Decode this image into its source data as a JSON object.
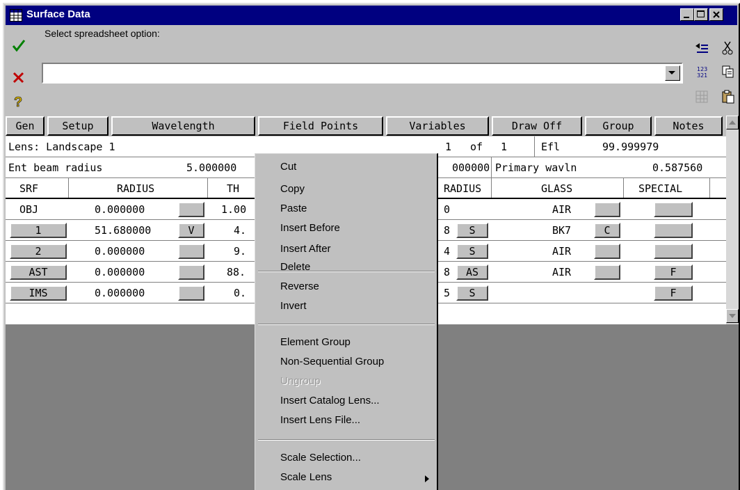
{
  "window": {
    "title": "Surface Data"
  },
  "toolbar": {
    "select_label": "Select spreadsheet option:",
    "option_value": ""
  },
  "tabs": [
    "Gen",
    "Setup",
    "Wavelength",
    "Field Points",
    "Variables",
    "Draw Off",
    "Group",
    "Notes"
  ],
  "info_row1": {
    "lens": "Lens: Landscape 1",
    "config": "1",
    "of": "of",
    "config_total": "1",
    "efl_label": "Efl",
    "efl_value": "99.999979"
  },
  "info_row2": {
    "ent_label": "Ent beam radius",
    "ent_value": "5.000000",
    "mid_value": "000000",
    "prim_label": "Primary wavln",
    "prim_value": "0.587560"
  },
  "columns": {
    "srf": "SRF",
    "radius": "RADIUS",
    "thickness": "TH",
    "ap_radius": "RADIUS",
    "glass": "GLASS",
    "special": "SPECIAL"
  },
  "rows": [
    {
      "srf": "OBJ",
      "radius": "0.000000",
      "radius_flag": "",
      "thick": "1.00",
      "ap": "0",
      "ap_flag": "",
      "glass": "AIR",
      "glass_flag": "",
      "special": ""
    },
    {
      "srf": "1",
      "radius": "51.680000",
      "radius_flag": "V",
      "thick": "4.",
      "ap": "8",
      "ap_flag": "S",
      "glass": "BK7",
      "glass_flag": "C",
      "special": ""
    },
    {
      "srf": "2",
      "radius": "0.000000",
      "radius_flag": "",
      "thick": "9.",
      "ap": "4",
      "ap_flag": "S",
      "glass": "AIR",
      "glass_flag": "",
      "special": ""
    },
    {
      "srf": "AST",
      "radius": "0.000000",
      "radius_flag": "",
      "thick": "88.",
      "ap": "8",
      "ap_flag": "AS",
      "glass": "AIR",
      "glass_flag": "",
      "special": "F"
    },
    {
      "srf": "IMS",
      "radius": "0.000000",
      "radius_flag": "",
      "thick": "0.",
      "ap": "5",
      "ap_flag": "S",
      "glass": "",
      "glass_flag": "",
      "special": "F"
    }
  ],
  "context_menu": {
    "items": [
      {
        "label": "Cut",
        "enabled": true
      },
      {
        "label": "Copy",
        "enabled": true
      },
      {
        "label": "Paste",
        "enabled": true
      },
      {
        "label": "Insert Before",
        "enabled": true
      },
      {
        "label": "Insert After",
        "enabled": true
      },
      {
        "label": "Delete",
        "enabled": true
      },
      {
        "label": "Reverse",
        "enabled": true
      },
      {
        "label": "Invert",
        "enabled": true
      },
      {
        "label": "Element Group",
        "enabled": true
      },
      {
        "label": "Non-Sequential Group",
        "enabled": true
      },
      {
        "label": "Ungroup",
        "enabled": false
      },
      {
        "label": "Insert Catalog Lens...",
        "enabled": true
      },
      {
        "label": "Insert Lens File...",
        "enabled": true
      },
      {
        "label": "Scale Selection...",
        "enabled": true
      },
      {
        "label": "Scale Lens",
        "enabled": true,
        "submenu": true
      }
    ]
  },
  "colors": {
    "titlebar": "#000080",
    "face": "#c0c0c0",
    "workspace": "#808080"
  }
}
